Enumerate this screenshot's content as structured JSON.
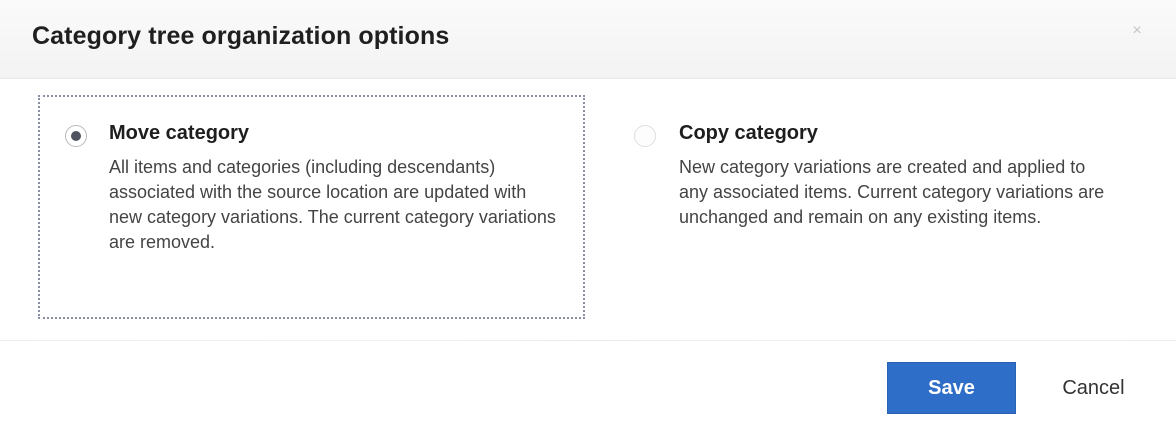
{
  "dialog": {
    "title": "Category tree organization options",
    "close_icon": "close-icon"
  },
  "options": {
    "move": {
      "title": "Move category",
      "description": "All items and categories (including descendants) associated with the source location are updated with new category variations. The current category variations are removed.",
      "selected": true
    },
    "copy": {
      "title": "Copy category",
      "description": "New category variations are created and applied to any associated items. Current category variations are unchanged and remain on any existing items.",
      "selected": false
    }
  },
  "footer": {
    "save_label": "Save",
    "cancel_label": "Cancel"
  },
  "colors": {
    "primary_button": "#2f6ec8",
    "selected_border": "#8a8fa6"
  }
}
